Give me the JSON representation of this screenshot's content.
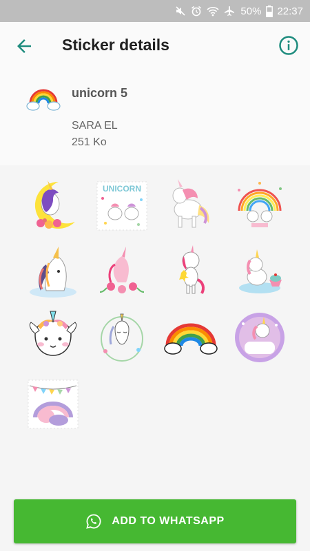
{
  "status_bar": {
    "battery_percent": "50%",
    "time": "22:37",
    "icons": [
      "mute-icon",
      "alarm-icon",
      "wifi-icon",
      "airplane-icon",
      "battery-icon"
    ]
  },
  "app_bar": {
    "title": "Sticker details",
    "back_icon": "arrow-back-icon",
    "info_icon": "info-icon"
  },
  "pack": {
    "name": "unicorn 5",
    "publisher": "SARA EL",
    "size": "251 Ko"
  },
  "stickers": [
    {
      "name": "unicorn-moon-sticker"
    },
    {
      "name": "unicorn-text-sticker",
      "text": "UNICORN"
    },
    {
      "name": "unicorn-pastel-sticker"
    },
    {
      "name": "unicorn-rainbow-sticker"
    },
    {
      "name": "unicorn-portrait-sticker"
    },
    {
      "name": "unicorn-pink-wreath-sticker"
    },
    {
      "name": "unicorn-star-sticker"
    },
    {
      "name": "unicorn-cupcake-sticker"
    },
    {
      "name": "unicorn-face-sticker"
    },
    {
      "name": "unicorn-sketch-sticker"
    },
    {
      "name": "rainbow-cloud-sticker"
    },
    {
      "name": "unicorn-purple-circle-sticker"
    },
    {
      "name": "unicorn-bunting-sticker"
    }
  ],
  "add_button": {
    "label": "ADD TO WHATSAPP",
    "icon": "whatsapp-icon"
  },
  "colors": {
    "accent": "#1e8c7e",
    "button_green": "#46b832",
    "status_bar": "#bdbdbd"
  }
}
